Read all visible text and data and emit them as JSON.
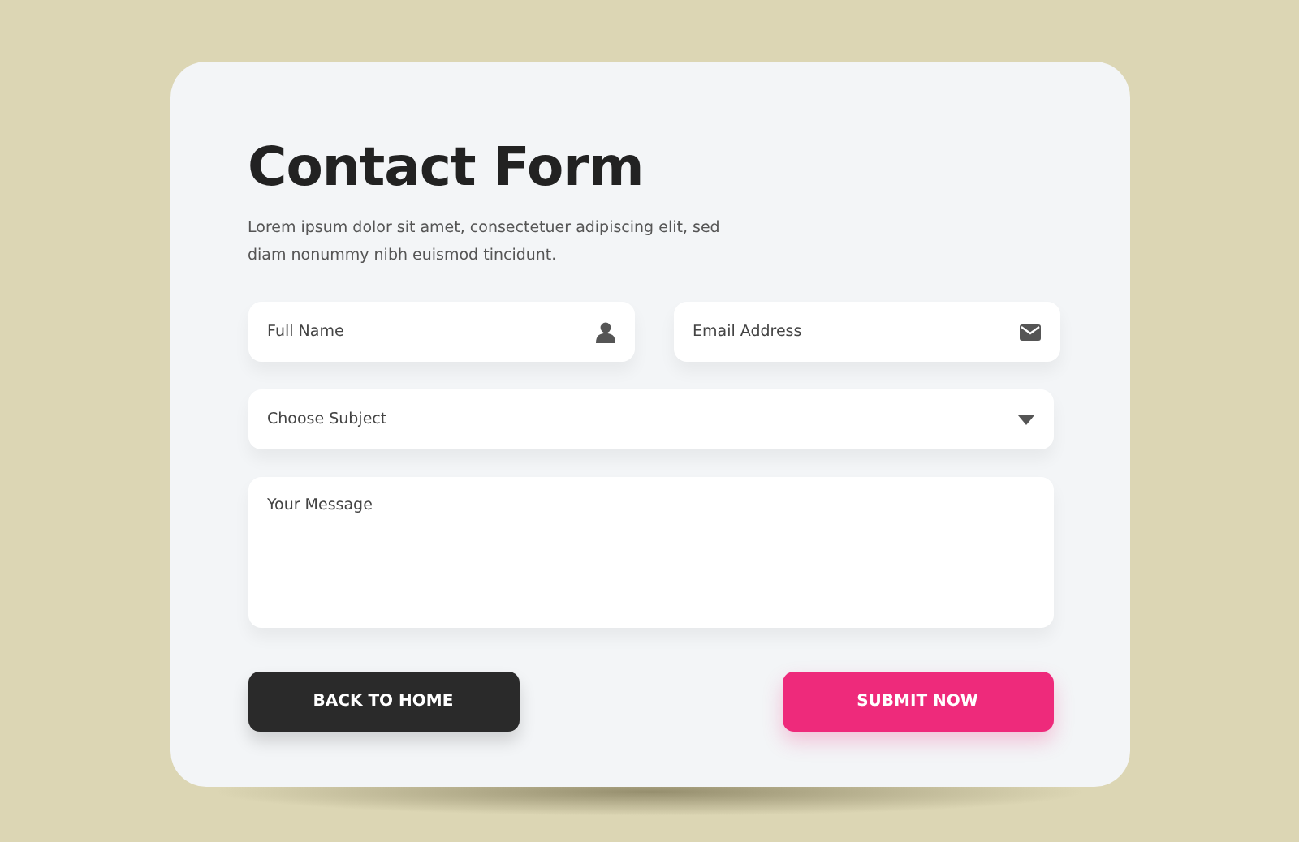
{
  "title": "Contact Form",
  "description": "Lorem ipsum dolor sit amet, consectetuer adipiscing elit, sed diam nonummy nibh euismod tincidunt.",
  "fields": [
    {
      "kind": "person",
      "placeholder": "Full Name"
    },
    {
      "kind": "email",
      "placeholder": "Email Address"
    },
    {
      "kind": "select",
      "placeholder": "Choose Subject"
    },
    {
      "kind": "textarea",
      "placeholder": "Your Message"
    }
  ],
  "buttons": [
    {
      "kind": "dark",
      "label": "BACK TO HOME"
    },
    {
      "kind": "accent",
      "label": "SUBMIT NOW"
    }
  ]
}
